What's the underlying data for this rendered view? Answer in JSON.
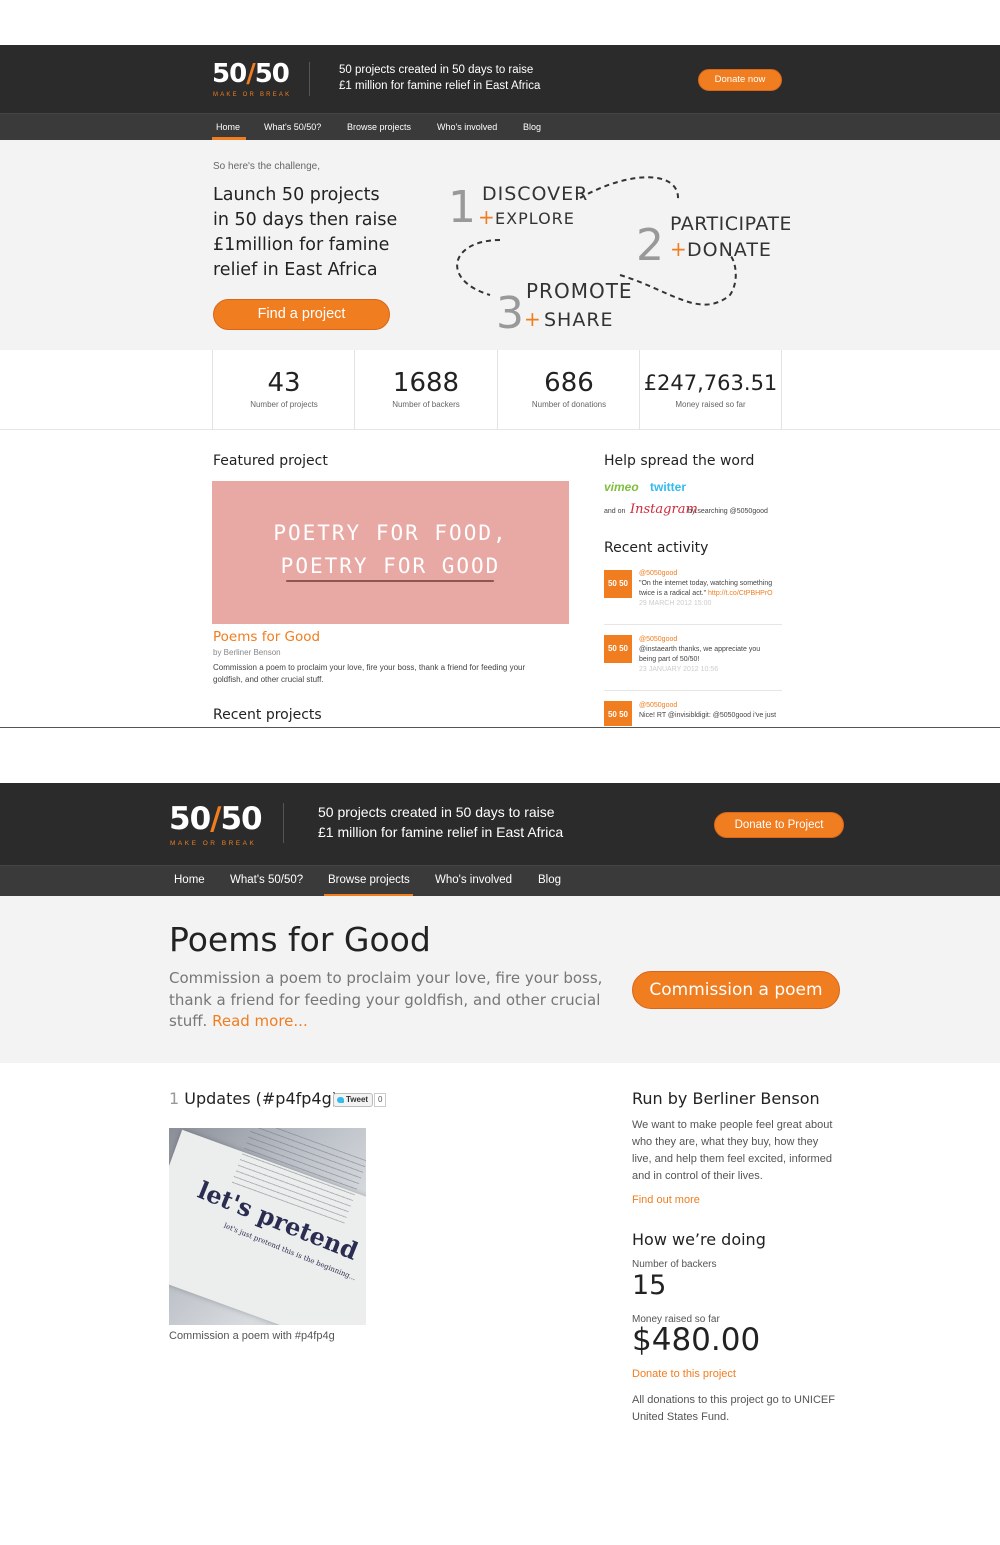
{
  "page1": {
    "logo": {
      "text_left": "50",
      "slash": "/",
      "text_right": "50",
      "sub": "MAKE OR BREAK"
    },
    "tagline": [
      "50 projects created in 50 days to raise",
      "£1 million for famine relief in East Africa"
    ],
    "donate_button": "Donate now",
    "nav": [
      "Home",
      "What's 50/50?",
      "Browse projects",
      "Who's involved",
      "Blog"
    ],
    "hero": {
      "intro": "So here's the challenge,",
      "headline": [
        "Launch 50 projects",
        "in 50 days then raise",
        "£1million for famine",
        "relief in East Africa"
      ],
      "cta": "Find a project",
      "steps": [
        {
          "num": "1",
          "a": "DISCOVER",
          "b": "EXPLORE"
        },
        {
          "num": "2",
          "a": "PARTICIPATE",
          "b": "DONATE"
        },
        {
          "num": "3",
          "a": "PROMOTE",
          "b": "SHARE"
        }
      ]
    },
    "stats": [
      {
        "value": "43",
        "label": "Number of projects"
      },
      {
        "value": "1688",
        "label": "Number of backers"
      },
      {
        "value": "686",
        "label": "Number of donations"
      },
      {
        "value": "£247,763.51",
        "label": "Money raised so far"
      }
    ],
    "featured": {
      "heading": "Featured project",
      "image_text": [
        "POETRY FOR FOOD,",
        "POETRY FOR GOOD"
      ],
      "image_color": "#e8a8a4",
      "title": "Poems for Good",
      "byline": "by Berliner Benson",
      "desc": [
        "Commission a poem to proclaim your love, fire your boss, thank a friend for feeding your",
        "goldfish, and other crucial stuff."
      ]
    },
    "recent_heading": "Recent projects",
    "spread": {
      "heading": "Help spread the word",
      "vimeo": "vimeo",
      "twitter": "twitter",
      "and_on": "and on",
      "instagram": "Instagram",
      "searching": "by searching @5050good"
    },
    "activity": {
      "heading": "Recent activity",
      "badge": "50 50",
      "items": [
        {
          "handle": "@5050good",
          "text1": "\"On the internet today, watching something",
          "text2": "twice is a radical act.\"",
          "link": "http://t.co/CtPBHPrO",
          "date": "29 MARCH 2012 15:00"
        },
        {
          "handle": "@5050good",
          "text1": "@instaearth thanks, we appreciate you",
          "text2": "being part of 50/50!",
          "link": "",
          "date": "23 JANUARY 2012 10:56"
        },
        {
          "handle": "@5050good",
          "text1": "Nice! RT @invisibldigit: @5050good i've just",
          "text2": "",
          "link": "",
          "date": ""
        }
      ]
    }
  },
  "page2": {
    "logo": {
      "text_left": "50",
      "slash": "/",
      "text_right": "50",
      "sub": "MAKE OR BREAK"
    },
    "tagline": [
      "50 projects created in 50 days to raise",
      "£1 million for famine relief in East Africa"
    ],
    "donate_button": "Donate to Project",
    "nav": [
      "Home",
      "What's 50/50?",
      "Browse projects",
      "Who's involved",
      "Blog"
    ],
    "title": "Poems for Good",
    "desc": [
      "Commission a poem to proclaim your love, fire your boss,",
      "thank a friend for feeding your goldfish, and other crucial",
      "stuff."
    ],
    "read_more": "Read more...",
    "cta": "Commission a poem",
    "updates": {
      "count": "1",
      "label": "Updates (#p4fp4g)",
      "tweet": "Tweet",
      "tweet_count": "0"
    },
    "photo": {
      "text1": "let's pretend",
      "text2": "let's just pretend this is the beginning...",
      "caption": "Commission a poem with #p4fp4g"
    },
    "run_by": {
      "heading": "Run by Berliner Benson",
      "text": [
        "We want to make people feel great about",
        "who they are, what they buy, how they",
        "live, and help them feel excited, informed",
        "and in control of their lives."
      ],
      "link": "Find out more"
    },
    "doing": {
      "heading": "How we’re doing",
      "backers_label": "Number of backers",
      "backers": "15",
      "money_label": "Money raised so far",
      "money": "$480.00",
      "donate_link": "Donate to this project",
      "note": [
        "All donations to this project go to UNICEF",
        "United States Fund."
      ]
    },
    "accent": "#f07d1f"
  }
}
